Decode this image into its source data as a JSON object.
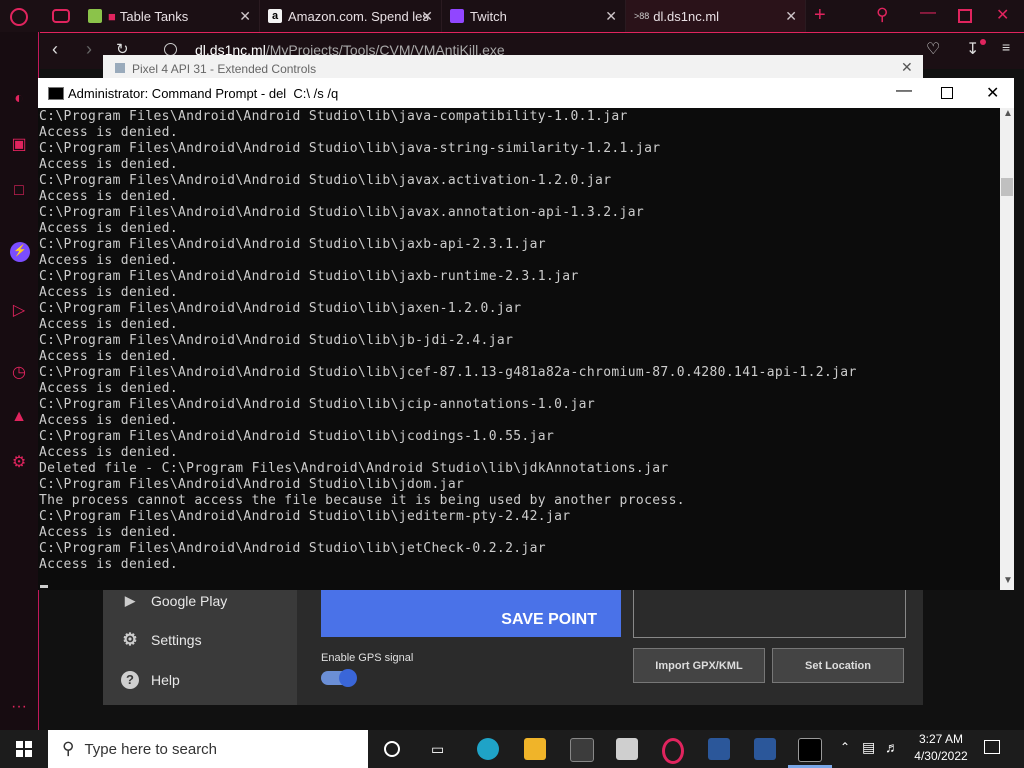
{
  "browser": {
    "tabs": [
      {
        "label": "Table Tanks",
        "icon_color": "#8bc34a"
      },
      {
        "label": "Amazon.com. Spend les",
        "icon_color": "#f3f3f3"
      },
      {
        "label": "Twitch",
        "icon_color": "#9146ff"
      },
      {
        "label": "dl.ds1nc.ml",
        "icon_color": "#444444"
      }
    ],
    "address": "dl.ds1nc.ml/MyProjects/Tools/CVM/VMAntiKill.exe",
    "address_host": "dl.ds1nc.ml",
    "address_path": "/MyProjects/Tools/CVM/VMAntiKill.exe"
  },
  "emulator": {
    "title": "Pixel 4 API 31 - Extended Controls",
    "menu": [
      {
        "label": "Google Play",
        "icon": "play-icon"
      },
      {
        "label": "Settings",
        "icon": "gear-icon"
      },
      {
        "label": "Help",
        "icon": "help-icon"
      }
    ],
    "save_point": "SAVE POINT",
    "gps_label": "Enable GPS signal",
    "import_label": "Import GPX/KML",
    "set_location_label": "Set Location"
  },
  "cmd": {
    "title": "Administrator: Command Prompt - del  C:\\ /s /q",
    "lines": [
      "C:\\Program Files\\Android\\Android Studio\\lib\\java-compatibility-1.0.1.jar",
      "Access is denied.",
      "C:\\Program Files\\Android\\Android Studio\\lib\\java-string-similarity-1.2.1.jar",
      "Access is denied.",
      "C:\\Program Files\\Android\\Android Studio\\lib\\javax.activation-1.2.0.jar",
      "Access is denied.",
      "C:\\Program Files\\Android\\Android Studio\\lib\\javax.annotation-api-1.3.2.jar",
      "Access is denied.",
      "C:\\Program Files\\Android\\Android Studio\\lib\\jaxb-api-2.3.1.jar",
      "Access is denied.",
      "C:\\Program Files\\Android\\Android Studio\\lib\\jaxb-runtime-2.3.1.jar",
      "Access is denied.",
      "C:\\Program Files\\Android\\Android Studio\\lib\\jaxen-1.2.0.jar",
      "Access is denied.",
      "C:\\Program Files\\Android\\Android Studio\\lib\\jb-jdi-2.4.jar",
      "Access is denied.",
      "C:\\Program Files\\Android\\Android Studio\\lib\\jcef-87.1.13-g481a82a-chromium-87.0.4280.141-api-1.2.jar",
      "Access is denied.",
      "C:\\Program Files\\Android\\Android Studio\\lib\\jcip-annotations-1.0.jar",
      "Access is denied.",
      "C:\\Program Files\\Android\\Android Studio\\lib\\jcodings-1.0.55.jar",
      "Access is denied.",
      "Deleted file - C:\\Program Files\\Android\\Android Studio\\lib\\jdkAnnotations.jar",
      "C:\\Program Files\\Android\\Android Studio\\lib\\jdom.jar",
      "The process cannot access the file because it is being used by another process.",
      "C:\\Program Files\\Android\\Android Studio\\lib\\jediterm-pty-2.42.jar",
      "Access is denied.",
      "C:\\Program Files\\Android\\Android Studio\\lib\\jetCheck-0.2.2.jar",
      "Access is denied."
    ]
  },
  "taskbar": {
    "search_placeholder": "Type here to search",
    "time": "3:27 AM",
    "date": "4/30/2022"
  }
}
